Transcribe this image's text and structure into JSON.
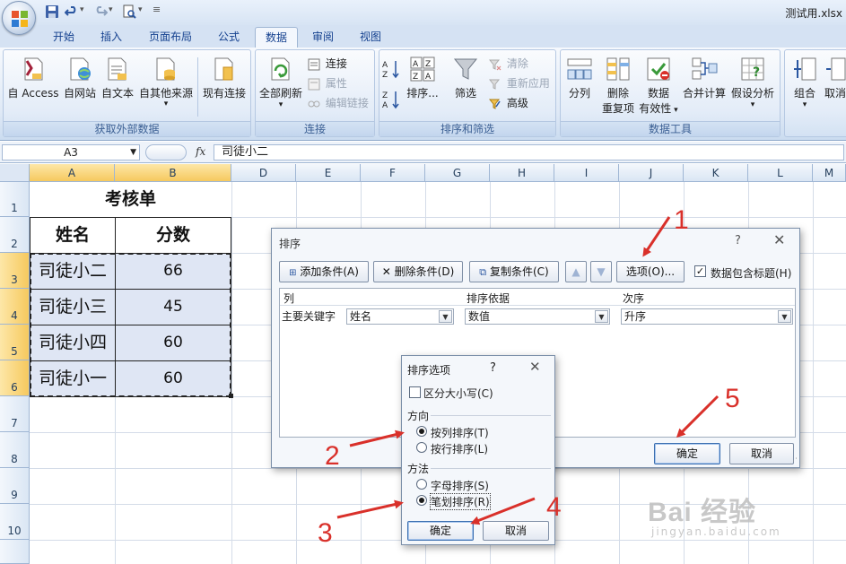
{
  "window": {
    "file_title": "测试用.xlsx"
  },
  "tabs": [
    {
      "label": "开始"
    },
    {
      "label": "插入"
    },
    {
      "label": "页面布局"
    },
    {
      "label": "公式"
    },
    {
      "label": "数据"
    },
    {
      "label": "审阅"
    },
    {
      "label": "视图"
    }
  ],
  "ribbon": {
    "external": {
      "label": "获取外部数据",
      "access": "自 Access",
      "web": "自网站",
      "text": "自文本",
      "other": "自其他来源",
      "existing": "现有连接"
    },
    "connections": {
      "label": "连接",
      "refresh_all": "全部刷新",
      "connections": "连接",
      "properties": "属性",
      "edit_links": "编辑链接"
    },
    "sort_filter": {
      "label": "排序和筛选",
      "sort": "排序...",
      "filter": "筛选",
      "clear": "清除",
      "reapply": "重新应用",
      "advanced": "高级"
    },
    "data_tools": {
      "label": "数据工具",
      "text_to_columns": "分列",
      "remove_dup_1": "删除",
      "remove_dup_2": "重复项",
      "validation_1": "数据",
      "validation_2": "有效性",
      "consolidate": "合并计算",
      "what_if": "假设分析"
    },
    "outline": {
      "group": "组合",
      "ungroup": "取消"
    }
  },
  "formula_bar": {
    "name_box": "A3",
    "fx": "fx",
    "value": "司徒小二"
  },
  "sheet": {
    "columns": [
      "A",
      "B",
      "D",
      "E",
      "F",
      "G",
      "H",
      "I",
      "J",
      "K",
      "L",
      "M"
    ],
    "rows": [
      "1",
      "2",
      "3",
      "4",
      "5",
      "6",
      "7",
      "8",
      "9",
      "10"
    ],
    "title": "考核单",
    "headers": {
      "name": "姓名",
      "score": "分数"
    },
    "records": [
      {
        "name": "司徒小二",
        "score": "66"
      },
      {
        "name": "司徒小三",
        "score": "45"
      },
      {
        "name": "司徒小四",
        "score": "60"
      },
      {
        "name": "司徒小一",
        "score": "60"
      }
    ]
  },
  "sort_dialog": {
    "title": "排序",
    "help": "?",
    "add_condition": "添加条件(A)",
    "delete_condition": "删除条件(D)",
    "copy_condition": "复制条件(C)",
    "options": "选项(O)...",
    "has_headers": "数据包含标题(H)",
    "grid_headers": {
      "column": "列",
      "sort_on": "排序依据",
      "order": "次序"
    },
    "row": {
      "key_label": "主要关键字",
      "column": "姓名",
      "sort_on": "数值",
      "order": "升序"
    },
    "ok": "确定",
    "cancel": "取消"
  },
  "options_dialog": {
    "title": "排序选项",
    "help": "?",
    "case_sensitive": "区分大小写(C)",
    "direction_label": "方向",
    "by_column": "按列排序(T)",
    "by_row": "按行排序(L)",
    "method_label": "方法",
    "alphabetical": "字母排序(S)",
    "stroke": "笔划排序(R)",
    "ok": "确定",
    "cancel": "取消",
    "selected_direction": "by_column",
    "selected_method": "stroke"
  },
  "annotations": [
    "1",
    "2",
    "3",
    "4",
    "5"
  ],
  "watermark": {
    "text": "Bai 经验",
    "url": "jingyan.baidu.com"
  },
  "colors": {
    "accent": "#15418f",
    "annotation": "#d9302a",
    "selected_header": "#f6c95e",
    "cell_fill": "#dfe6f4"
  }
}
